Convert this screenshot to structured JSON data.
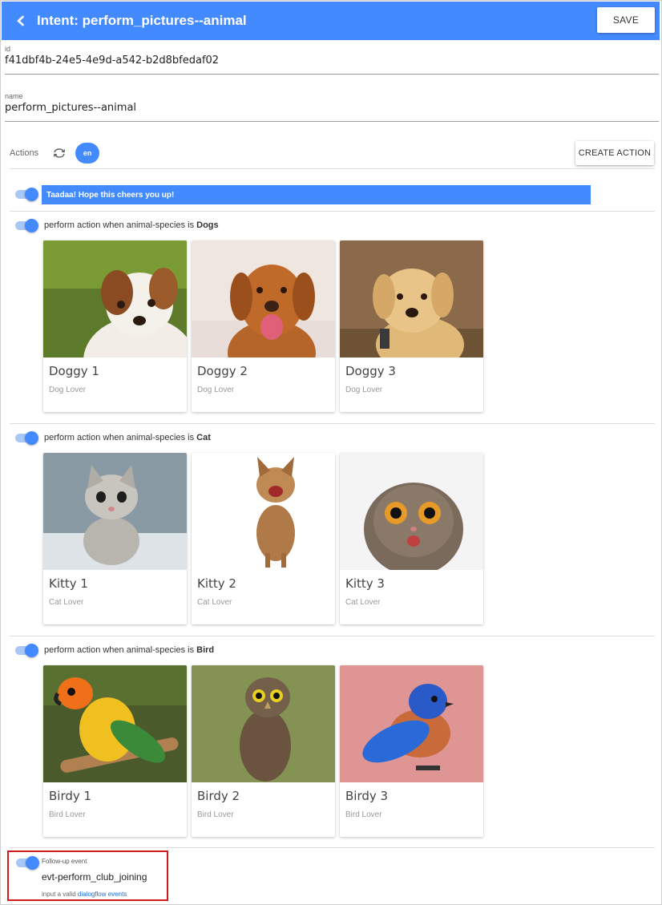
{
  "header": {
    "title": "Intent: perform_pictures--animal",
    "save_label": "SAVE",
    "back_icon": "chevron-left-icon",
    "color": "#448aff"
  },
  "fields": {
    "id": {
      "label": "id",
      "value": "f41dbf4b-24e5-4e9d-a542-b2d8bfedaf02"
    },
    "name": {
      "label": "name",
      "value": "perform_pictures--animal"
    }
  },
  "actions": {
    "label": "Actions",
    "sync_icon": "sync-icon",
    "language": "en",
    "create_label": "CREATE ACTION"
  },
  "text_action": {
    "enabled": true,
    "message": "Taadaa! Hope this cheers you up!"
  },
  "conditional_actions": [
    {
      "enabled": true,
      "prefix": "perform action when animal-species is ",
      "value": "Dogs",
      "cards": [
        {
          "title": "Doggy 1",
          "subtitle": "Dog Lover"
        },
        {
          "title": "Doggy 2",
          "subtitle": "Dog Lover"
        },
        {
          "title": "Doggy 3",
          "subtitle": "Dog Lover"
        }
      ]
    },
    {
      "enabled": true,
      "prefix": "perform action when animal-species is ",
      "value": "Cat",
      "cards": [
        {
          "title": "Kitty 1",
          "subtitle": "Cat Lover"
        },
        {
          "title": "Kitty 2",
          "subtitle": "Cat Lover"
        },
        {
          "title": "Kitty 3",
          "subtitle": "Cat Lover"
        }
      ]
    },
    {
      "enabled": true,
      "prefix": "perform action when animal-species is ",
      "value": "Bird",
      "cards": [
        {
          "title": "Birdy 1",
          "subtitle": "Bird Lover"
        },
        {
          "title": "Birdy 2",
          "subtitle": "Bird Lover"
        },
        {
          "title": "Birdy 3",
          "subtitle": "Bird Lover"
        }
      ]
    }
  ],
  "followup": {
    "enabled": true,
    "label": "Follow-up event",
    "value": "evt-perform_club_joining",
    "hint_prefix": "input a valid ",
    "hint_link": "dialogflow events",
    "highlight_color": "#d11a1a"
  }
}
